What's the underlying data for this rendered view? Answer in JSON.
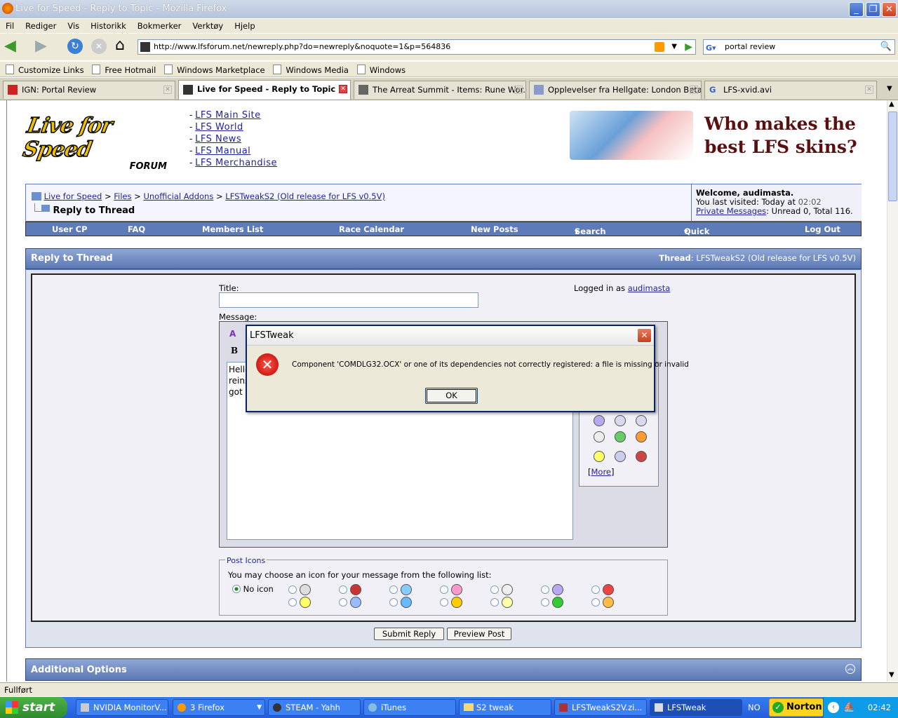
{
  "window": {
    "title": "Live for Speed - Reply to Topic - Mozilla Firefox"
  },
  "menu": [
    "Fil",
    "Rediger",
    "Vis",
    "Historikk",
    "Bokmerker",
    "Verktøy",
    "Hjelp"
  ],
  "nav": {
    "url": "http://www.lfsforum.net/newreply.php?do=newreply&noquote=1&p=564836",
    "search": "portal review"
  },
  "bookmarks": [
    "Customize Links",
    "Free Hotmail",
    "Windows Marketplace",
    "Windows Media",
    "Windows"
  ],
  "tabs": [
    {
      "label": "IGN: Portal Review"
    },
    {
      "label": "Live for Speed - Reply to Topic"
    },
    {
      "label": "The Arreat Summit - Items: Rune Wor..."
    },
    {
      "label": "Opplevelser fra Hellgate: London Beta..."
    },
    {
      "label": "LFS-xvid.avi"
    }
  ],
  "site": {
    "logo_main": "Live for Speed",
    "logo_sub": "FORUM",
    "links": [
      "LFS Main Site",
      "LFS World",
      "LFS News",
      "LFS Manual",
      "LFS Merchandise"
    ],
    "banner": "Who makes the best LFS skins?",
    "breadcrumb": [
      "Live for Speed",
      "Files",
      "Unofficial Addons",
      "LFSTweakS2 (Old release for LFS v0.5V)"
    ],
    "page_heading": "Reply to Thread",
    "welcome": "Welcome, audimasta.",
    "last_visited_label": "You last visited: Today at ",
    "last_visited_time": "02:02",
    "pm_link": "Private Messages",
    "pm_info": ": Unread 0, Total 116.",
    "navitems": [
      "User CP",
      "FAQ",
      "Members List",
      "Race Calendar",
      "New Posts",
      "Search",
      "Quick Links",
      "Log Out"
    ],
    "reply_title": "Reply to Thread",
    "thread_label": "Thread",
    "thread_name": ": LFSTweakS2 (Old release for LFS v0.5V)",
    "title_label": "Title:",
    "logged_in_label": "Logged in as ",
    "logged_in_user": "audimasta",
    "message_label": "Message:",
    "message_lines": [
      "Hello",
      "reins",
      "got"
    ],
    "more_link": "More",
    "post_icons_legend": "Post Icons",
    "post_icons_text": "You may choose an icon for your message from the following list:",
    "no_icon": "No icon",
    "submit": "Submit Reply",
    "preview": "Preview Post",
    "additional": "Additional Options"
  },
  "dialog": {
    "title": "LFSTweak",
    "message": "Component 'COMDLG32.OCX' or one of its dependencies not correctly registered: a file is missing or invalid",
    "ok": "OK"
  },
  "status": "Fullført",
  "taskbar": {
    "start": "start",
    "items": [
      "NVIDIA MonitorV...",
      "3 Firefox",
      "STEAM - Yahh",
      "iTunes",
      "S2 tweak",
      "LFSTweakS2V.zi...",
      "LFSTweak"
    ],
    "lang": "NO",
    "norton": "Norton",
    "clock": "02:42"
  }
}
